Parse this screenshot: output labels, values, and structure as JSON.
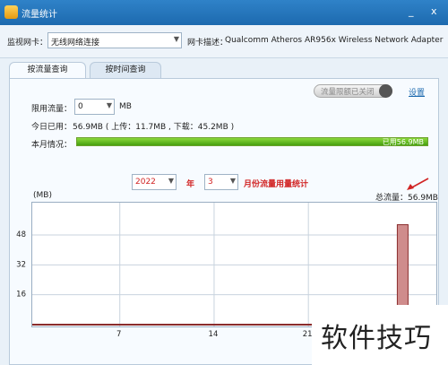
{
  "window": {
    "title": "流量统计",
    "min_glyph": "_",
    "close_glyph": "x"
  },
  "toolbar": {
    "monitor_label": "监视网卡：",
    "adapter_value": "无线网络连接",
    "desc_label": "网卡描述：",
    "desc_value": "Qualcomm Atheros AR956x Wireless Network Adapter"
  },
  "tabs": [
    {
      "label": "按流量查询",
      "active": true
    },
    {
      "label": "按时间查询",
      "active": false
    }
  ],
  "limit": {
    "label": "限用流量：",
    "value": "0",
    "unit": "MB",
    "toggle_label": "流量限额已关闭",
    "settings_link": "设置"
  },
  "usage": {
    "today_label": "今日已用：",
    "today_text": "56.9MB ( 上传：11.7MB , 下载：45.2MB )",
    "month_label": "本月情况：",
    "month_bar_text": "已用56.9MB",
    "month_fill": 1.0
  },
  "period": {
    "year_value": "2022",
    "year_label": "年",
    "month_value": "3",
    "month_label": "月份流量用量统计"
  },
  "chart_data": {
    "type": "bar",
    "ylabel": "(MB)",
    "total_label": "总流量：56.9MB",
    "yticks": [
      16,
      32,
      48
    ],
    "ylim": [
      0,
      60
    ],
    "xticks": [
      7,
      14,
      21
    ],
    "xlim": [
      0.5,
      30.5
    ],
    "x": [
      28
    ],
    "values": [
      53.5
    ]
  },
  "watermark": {
    "text": "软件技巧"
  },
  "colors": {
    "titlebar": "#1d6aaf",
    "progress": "#46a010",
    "bar": "#cf8c8c",
    "accent_red": "#d12424"
  }
}
